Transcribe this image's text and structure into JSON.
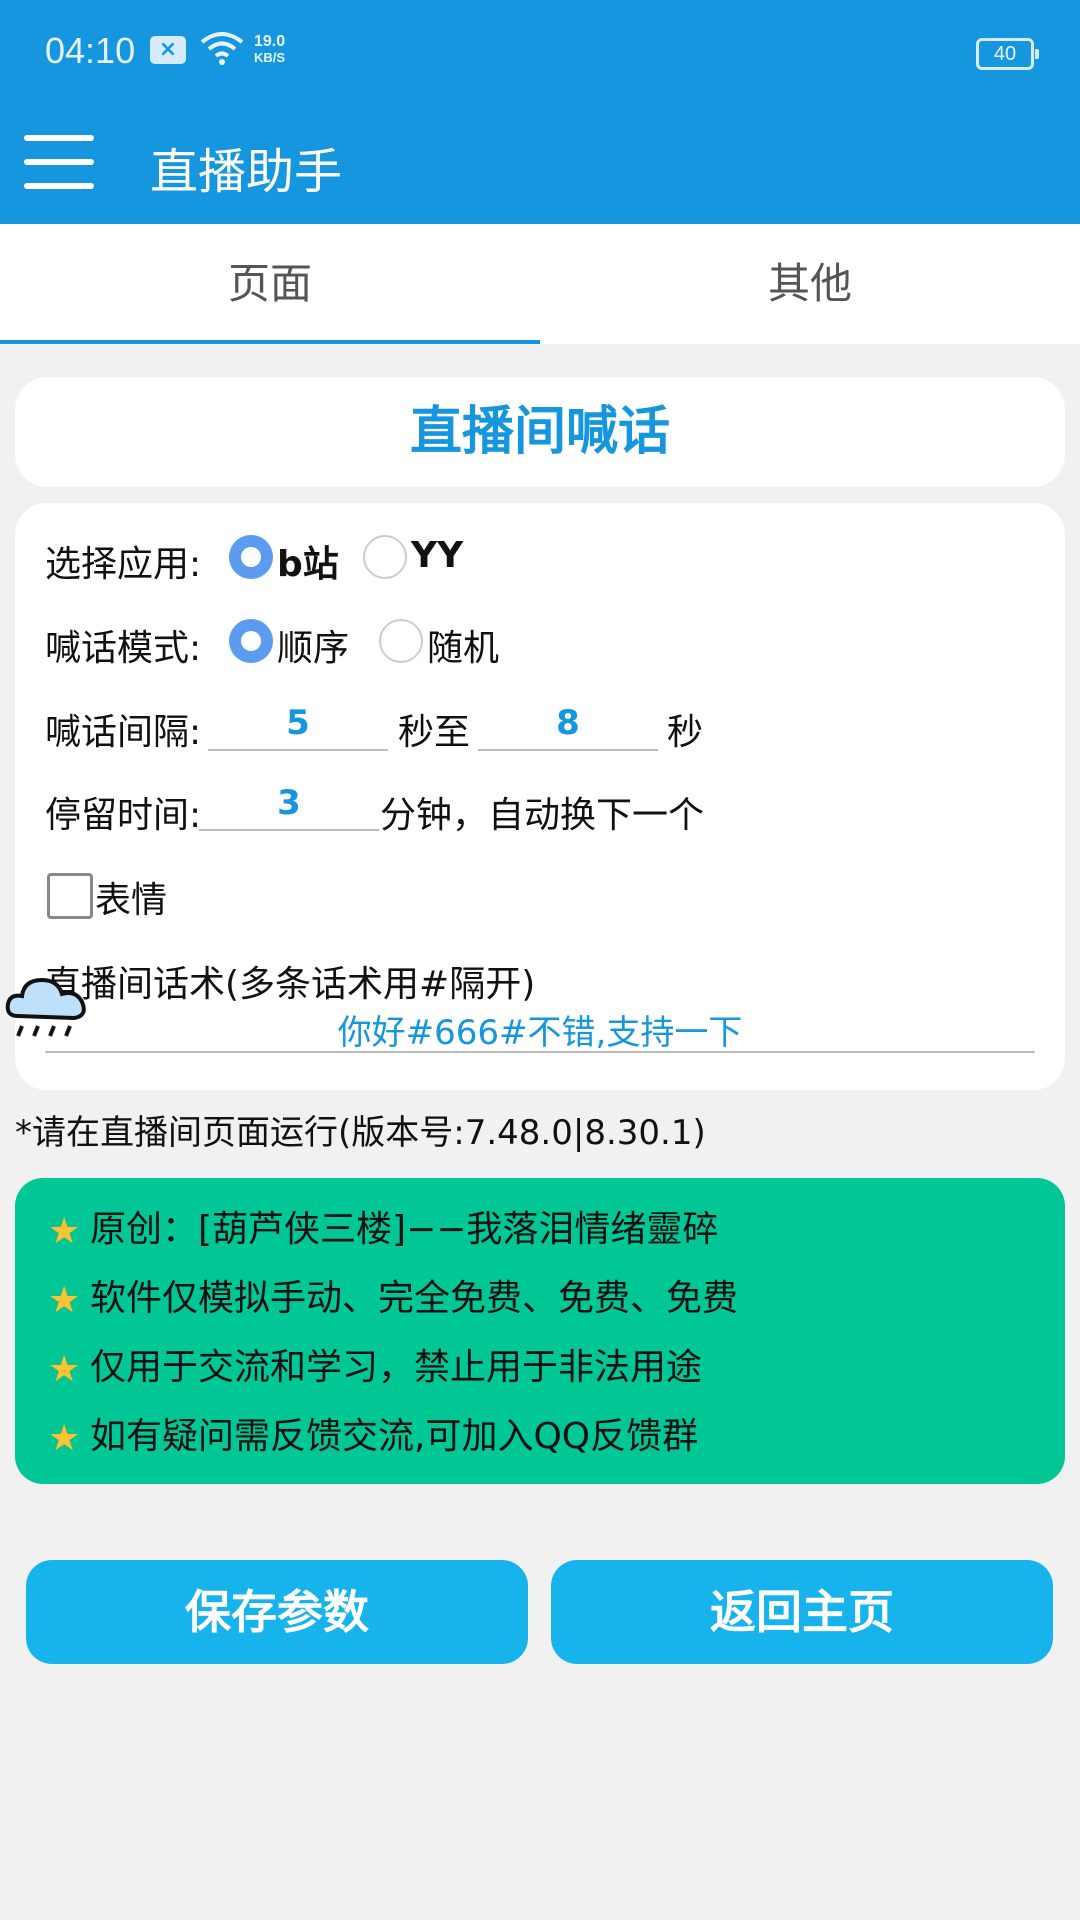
{
  "status_bar": {
    "time": "04:10",
    "speed_value": "19.0",
    "speed_unit": "KB/S",
    "battery": "40",
    "icons": [
      "notification-x-icon",
      "wifi-icon",
      "battery-icon"
    ]
  },
  "app_bar": {
    "title": "直播助手",
    "menu_icon": "hamburger-menu-icon"
  },
  "tabs": [
    {
      "label": "页面",
      "active": true
    },
    {
      "label": "其他",
      "active": false
    }
  ],
  "header": {
    "title": "直播间喊话"
  },
  "form": {
    "select_app": {
      "label": "选择应用:",
      "options": [
        {
          "label": "b站",
          "selected": true
        },
        {
          "label": "YY",
          "selected": false
        }
      ]
    },
    "mode": {
      "label": "喊话模式:",
      "options": [
        {
          "label": "顺序",
          "selected": true
        },
        {
          "label": "随机",
          "selected": false
        }
      ]
    },
    "interval": {
      "label": "喊话间隔:",
      "min_value": "5",
      "between": "秒至",
      "max_value": "8",
      "unit": "秒"
    },
    "stay": {
      "label": "停留时间:",
      "value": "3",
      "suffix": "分钟，自动换下一个"
    },
    "emoji": {
      "label": "表情",
      "checked": false
    },
    "script": {
      "label": "直播间话术(多条话术用#隔开)",
      "value": "你好#666#不错,支持一下"
    }
  },
  "notice": "*请在直播间页面运行(版本号:7.48.0|8.30.1)",
  "info_lines": [
    "原创：[葫芦侠三楼]−−我落泪情绪靈碎",
    "软件仅模拟手动、完全免费、免费、免费",
    "仅用于交流和学习，禁止用于非法用途",
    "如有疑问需反馈交流,可加入QQ反馈群"
  ],
  "buttons": {
    "save": "保存参数",
    "home": "返回主页"
  },
  "colors": {
    "primary": "#1596de",
    "accent_button": "#17b3ec",
    "green_panel": "#00c795",
    "radio_on": "#5b9cf1"
  }
}
